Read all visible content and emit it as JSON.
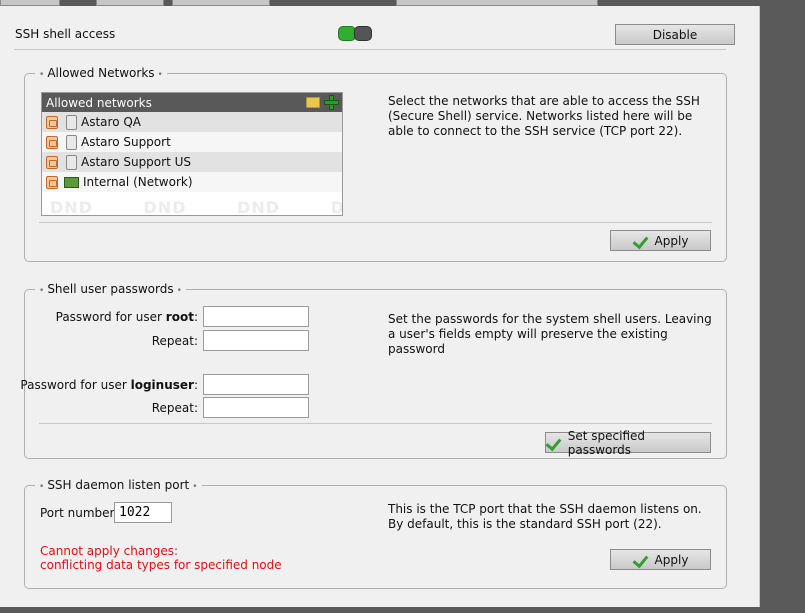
{
  "ssh_access": {
    "label": "SSH shell access",
    "toggle_state": "on",
    "disable_label": "Disable"
  },
  "allowed_networks": {
    "legend": "Allowed Networks",
    "list_header": "Allowed networks",
    "items": [
      {
        "label": "Astaro QA",
        "type": "host"
      },
      {
        "label": "Astaro Support",
        "type": "host"
      },
      {
        "label": "Astaro Support US",
        "type": "host"
      },
      {
        "label": "Internal (Network)",
        "type": "network"
      }
    ],
    "dnd_watermark": "DND DND DND DND",
    "description": "Select the networks that are able to access the SSH (Secure Shell) service. Networks listed here will be able to connect to the SSH service (TCP port 22).",
    "apply_label": "Apply"
  },
  "passwords": {
    "legend": "Shell user passwords",
    "root_label_prefix": "Password for user ",
    "root_user": "root",
    "login_user": "loginuser",
    "repeat_label": "Repeat:",
    "description": "Set the passwords for the system shell users. Leaving a user's fields empty will preserve the existing password",
    "set_label": "Set specified passwords"
  },
  "listen_port": {
    "legend": "SSH daemon listen port",
    "port_label": "Port number:",
    "port_value": "1022",
    "description": "This is the TCP port that the SSH daemon listens on. By default, this is the standard SSH port (22).",
    "error_line1": "Cannot apply changes:",
    "error_line2": "conflicting data types for specified node",
    "apply_label": "Apply"
  }
}
